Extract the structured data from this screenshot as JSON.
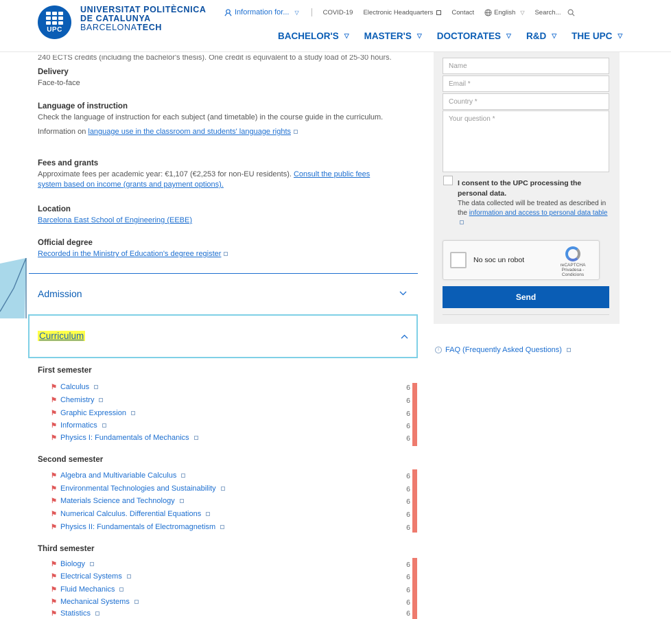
{
  "header": {
    "logo_abbr": "UPC",
    "university_line1": "UNIVERSITAT POLITÈCNICA",
    "university_line2": "DE CATALUNYA",
    "university_line3a": "BARCELONA",
    "university_line3b": "TECH",
    "top_links": {
      "information_for": "Information for...",
      "covid": "COVID-19",
      "electronic_hq": "Electronic Headquarters",
      "contact": "Contact",
      "language": "English",
      "search": "Search..."
    },
    "main_nav": [
      "BACHELOR'S",
      "MASTER'S",
      "DOCTORATES",
      "R&D",
      "THE UPC"
    ]
  },
  "content": {
    "cut_text": "240 ECTS credits (including the bachelor's thesis). One credit is equivalent to a study load of 25-30 hours.",
    "delivery": {
      "title": "Delivery",
      "value": "Face-to-face"
    },
    "language": {
      "title": "Language of instruction",
      "text": "Check the language of instruction for each subject (and timetable) in the course guide in the curriculum.",
      "info_prefix": "Information on ",
      "info_link": "language use in the classroom and students' language rights"
    },
    "fees": {
      "title": "Fees and grants",
      "text": "Approximate fees per academic year: €1,107 (€2,253 for non-EU residents). ",
      "link1": "Consult the public fees",
      "link2": "system based on income (grants and payment options)."
    },
    "location": {
      "title": "Location",
      "link": "Barcelona East School of Engineering (EEBE)"
    },
    "official": {
      "title": "Official degree",
      "link": "Recorded in the Ministry of Education's degree register"
    },
    "admission": "Admission",
    "curriculum": "Curriculum"
  },
  "semesters": [
    {
      "title": "First semester",
      "courses": [
        {
          "name": "Calculus",
          "credits": "6"
        },
        {
          "name": "Chemistry",
          "credits": "6"
        },
        {
          "name": "Graphic Expression",
          "credits": "6"
        },
        {
          "name": "Informatics",
          "credits": "6"
        },
        {
          "name": "Physics I: Fundamentals of Mechanics",
          "credits": "6"
        }
      ]
    },
    {
      "title": "Second semester",
      "courses": [
        {
          "name": "Algebra and Multivariable Calculus",
          "credits": "6"
        },
        {
          "name": "Environmental Technologies and Sustainability",
          "credits": "6"
        },
        {
          "name": "Materials Science and Technology",
          "credits": "6"
        },
        {
          "name": "Numerical Calculus. Differential Equations",
          "credits": "6"
        },
        {
          "name": "Physics II: Fundamentals of Electromagnetism",
          "credits": "6"
        }
      ]
    },
    {
      "title": "Third semester",
      "courses": [
        {
          "name": "Biology",
          "credits": "6"
        },
        {
          "name": "Electrical Systems",
          "credits": "6"
        },
        {
          "name": "Fluid Mechanics",
          "credits": "6"
        },
        {
          "name": "Mechanical Systems",
          "credits": "6"
        },
        {
          "name": "Statistics",
          "credits": "6"
        }
      ]
    }
  ],
  "form": {
    "name_placeholder": "Name",
    "email_placeholder": "Email *",
    "country_placeholder": "Country *",
    "question_placeholder": "Your question *",
    "consent_bold": "I consent to the UPC processing the personal data.",
    "consent_text": "The data collected will be treated as described in the ",
    "consent_link": "information and access to personal data table",
    "captcha_label": "No soc un robot",
    "captcha_brand": "reCAPTCHA",
    "captcha_terms": "Privadesa - Condicions",
    "send": "Send"
  },
  "faq": "FAQ (Frequently Asked Questions)",
  "colors": {
    "brand": "#0a5db5",
    "link": "#1d6fd0",
    "credit_bar": "#ee7b6e",
    "highlight": "#ffff4a",
    "focus_border": "#7fd0e6"
  }
}
